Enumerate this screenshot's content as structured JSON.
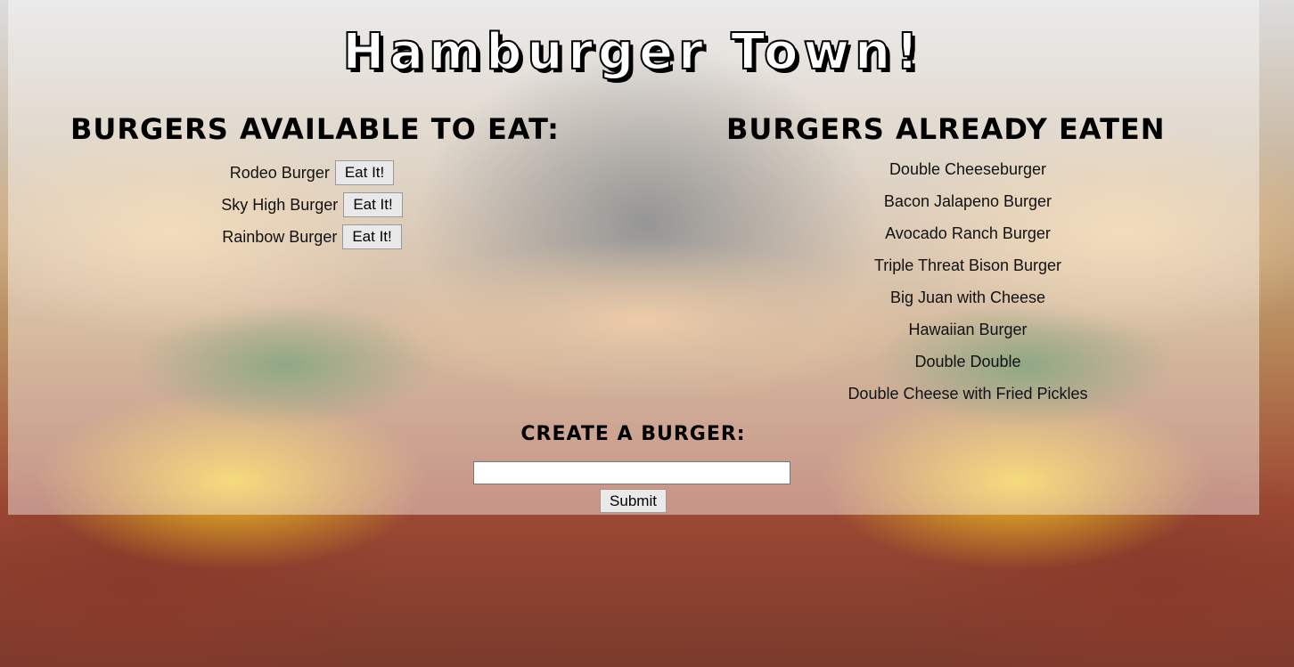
{
  "page": {
    "title": "Hamburger Town!"
  },
  "available": {
    "heading": "Burgers Available to Eat:",
    "items": [
      {
        "name": "Rodeo Burger",
        "button": "Eat It!"
      },
      {
        "name": "Sky High Burger",
        "button": "Eat It!"
      },
      {
        "name": "Rainbow Burger",
        "button": "Eat It!"
      }
    ]
  },
  "eaten": {
    "heading": "Burgers Already Eaten",
    "items": [
      "Double Cheeseburger",
      "Bacon Jalapeno Burger",
      "Avocado Ranch Burger",
      "Triple Threat Bison Burger",
      "Big Juan with Cheese",
      "Hawaiian Burger",
      "Double Double",
      "Double Cheese with Fried Pickles"
    ]
  },
  "create": {
    "heading": "Create a Burger:",
    "input_value": "",
    "input_placeholder": "",
    "submit_label": "Submit"
  }
}
